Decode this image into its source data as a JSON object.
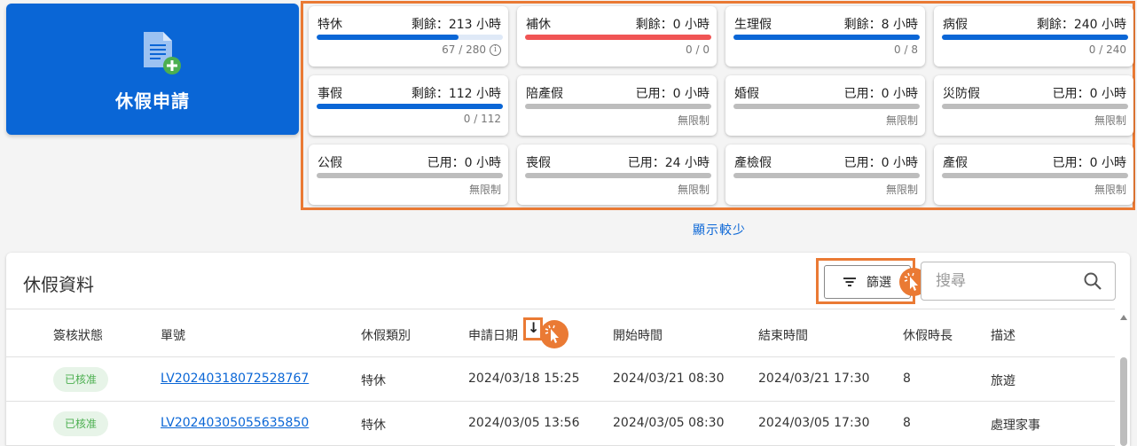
{
  "apply": {
    "label": "休假申請",
    "icon": "document-add-icon"
  },
  "leave_cards": [
    {
      "name": "特休",
      "balance": "剩餘：213 小時",
      "sub": "67 / 280",
      "used_fraction": 0.24,
      "bar_style": "light",
      "info": true
    },
    {
      "name": "補休",
      "balance": "剩餘：0 小時",
      "sub": "0 / 0",
      "bar_style": "red"
    },
    {
      "name": "生理假",
      "balance": "剩餘：8 小時",
      "sub": "0 / 8",
      "bar_style": "blue"
    },
    {
      "name": "病假",
      "balance": "剩餘：240 小時",
      "sub": "0 / 240",
      "bar_style": "blue"
    },
    {
      "name": "事假",
      "balance": "剩餘：112 小時",
      "sub": "0 / 112",
      "bar_style": "blue"
    },
    {
      "name": "陪產假",
      "balance": "已用：0 小時",
      "sub": "無限制",
      "bar_style": "gray"
    },
    {
      "name": "婚假",
      "balance": "已用：0 小時",
      "sub": "無限制",
      "bar_style": "gray"
    },
    {
      "name": "災防假",
      "balance": "已用：0 小時",
      "sub": "無限制",
      "bar_style": "gray"
    },
    {
      "name": "公假",
      "balance": "已用：0 小時",
      "sub": "無限制",
      "bar_style": "gray"
    },
    {
      "name": "喪假",
      "balance": "已用：24 小時",
      "sub": "無限制",
      "bar_style": "gray"
    },
    {
      "name": "產檢假",
      "balance": "已用：0 小時",
      "sub": "無限制",
      "bar_style": "gray"
    },
    {
      "name": "產假",
      "balance": "已用：0 小時",
      "sub": "無限制",
      "bar_style": "gray"
    }
  ],
  "show_less": "顯示較少",
  "records": {
    "title": "休假資料",
    "filter_label": "篩選",
    "search_placeholder": "搜尋",
    "columns": [
      "簽核狀態",
      "單號",
      "休假類別",
      "申請日期",
      "開始時間",
      "結束時間",
      "休假時長",
      "描述"
    ],
    "sort_indicator": "↓",
    "rows": [
      {
        "status": "已核准",
        "id": "LV20240318072528767",
        "type": "特休",
        "applied": "2024/03/18 15:25",
        "start": "2024/03/21 08:30",
        "end": "2024/03/21 17:30",
        "hours": "8",
        "desc": "旅遊"
      },
      {
        "status": "已核准",
        "id": "LV20240305055635850",
        "type": "特休",
        "applied": "2024/03/05 13:56",
        "start": "2024/03/05 08:30",
        "end": "2024/03/05 17:30",
        "hours": "8",
        "desc": "處理家事"
      }
    ]
  },
  "colors": {
    "primary": "#0a66d6",
    "highlight": "#ea7a34",
    "approved": "#4caf50",
    "danger": "#f05454"
  }
}
